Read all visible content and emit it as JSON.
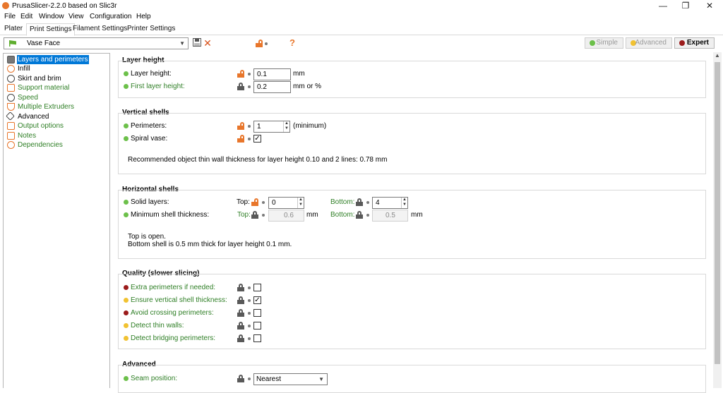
{
  "window": {
    "title": "PrusaSlicer-2.2.0 based on Slic3r",
    "minimize": "—",
    "maximize": "❐",
    "close": "✕"
  },
  "menu": [
    "File",
    "Edit",
    "Window",
    "View",
    "Configuration",
    "Help"
  ],
  "tabs": [
    "Plater",
    "Print Settings",
    "Filament Settings",
    "Printer Settings"
  ],
  "preset": {
    "name": "Vase Face"
  },
  "modes": {
    "simple": "Simple",
    "advanced": "Advanced",
    "expert": "Expert"
  },
  "colors": {
    "simple": "#6cc04a",
    "advanced": "#f1c232",
    "expert": "#9b1b1b",
    "selection": "#0078d7"
  },
  "sidebar": [
    {
      "label": "Layers and perimeters",
      "icon": "layers-icon"
    },
    {
      "label": "Infill",
      "icon": "infill-icon"
    },
    {
      "label": "Skirt and brim",
      "icon": "skirt-icon"
    },
    {
      "label": "Support material",
      "icon": "support-icon"
    },
    {
      "label": "Speed",
      "icon": "speed-icon"
    },
    {
      "label": "Multiple Extruders",
      "icon": "extruder-icon"
    },
    {
      "label": "Advanced",
      "icon": "wrench-icon"
    },
    {
      "label": "Output options",
      "icon": "output-icon"
    },
    {
      "label": "Notes",
      "icon": "notes-icon"
    },
    {
      "label": "Dependencies",
      "icon": "dependencies-icon"
    }
  ],
  "layer_height": {
    "title": "Layer height",
    "layer_height_label": "Layer height:",
    "layer_height": "0.1",
    "layer_height_unit": "mm",
    "first_layer_label": "First layer height:",
    "first_layer": "0.2",
    "first_layer_unit": "mm or %"
  },
  "vertical": {
    "title": "Vertical shells",
    "perimeters_label": "Perimeters:",
    "perimeters": "1",
    "perimeters_note": "(minimum)",
    "spiral_label": "Spiral vase:",
    "spiral": "✓",
    "recommend": "Recommended object thin wall thickness for layer height 0.10 and 2 lines: 0.78 mm"
  },
  "horizontal": {
    "title": "Horizontal shells",
    "solid_label": "Solid layers:",
    "top_label": "Top:",
    "bottom_label": "Bottom:",
    "top": "0",
    "bottom": "4",
    "min_label": "Minimum shell thickness:",
    "min_top": "0.6",
    "min_bottom": "0.5",
    "unit": "mm",
    "note1": "Top is open.",
    "note2": "Bottom shell is 0.5 mm thick for layer height 0.1 mm."
  },
  "quality": {
    "title": "Quality (slower slicing)",
    "items": [
      {
        "label": "Extra perimeters if needed:",
        "checked": ""
      },
      {
        "label": "Ensure vertical shell thickness:",
        "checked": "✓"
      },
      {
        "label": "Avoid crossing perimeters:",
        "checked": ""
      },
      {
        "label": "Detect thin walls:",
        "checked": ""
      },
      {
        "label": "Detect bridging perimeters:",
        "checked": ""
      }
    ]
  },
  "advanced": {
    "title": "Advanced",
    "seam_label": "Seam position:",
    "seam": "Nearest"
  }
}
